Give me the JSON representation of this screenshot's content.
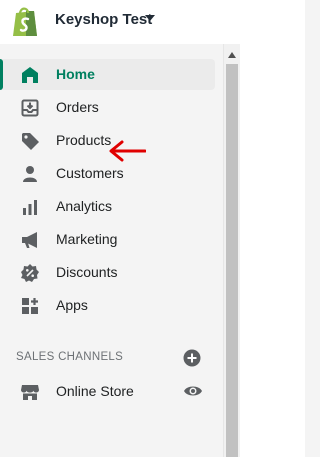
{
  "store": {
    "name": "Keyshop Test",
    "logo_icon": "shopify-bag-icon",
    "menu_icon": "caret-down-icon"
  },
  "nav": {
    "items": [
      {
        "label": "Home",
        "icon": "home-icon",
        "active": true
      },
      {
        "label": "Orders",
        "icon": "orders-icon"
      },
      {
        "label": "Products",
        "icon": "tag-icon"
      },
      {
        "label": "Customers",
        "icon": "person-icon"
      },
      {
        "label": "Analytics",
        "icon": "bar-chart-icon"
      },
      {
        "label": "Marketing",
        "icon": "megaphone-icon"
      },
      {
        "label": "Discounts",
        "icon": "discount-icon"
      },
      {
        "label": "Apps",
        "icon": "apps-icon"
      }
    ]
  },
  "sales_channels": {
    "title": "SALES CHANNELS",
    "add_icon": "plus-circle-icon",
    "items": [
      {
        "label": "Online Store",
        "icon": "storefront-icon",
        "action_icon": "eye-icon"
      }
    ]
  },
  "annotation": {
    "icon": "red-arrow-icon",
    "color": "#e00000"
  },
  "colors": {
    "accent": "#008060",
    "icon": "#5c5f62",
    "text": "#202223"
  }
}
